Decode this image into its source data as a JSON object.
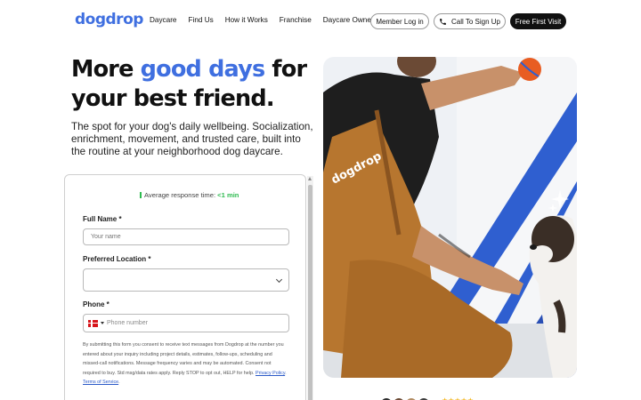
{
  "header": {
    "logo": "dogdrop",
    "nav": [
      "Daycare",
      "Find Us",
      "How it Works",
      "Franchise",
      "Daycare Owners"
    ],
    "member_login": "Member Log in",
    "call_signup": "Call To Sign Up",
    "free_visit": "Free First Visit"
  },
  "hero": {
    "headline_part1": "More ",
    "headline_accent": "good days",
    "headline_part2": " for your best friend.",
    "subcopy": "The spot for your dog's daily wellbeing. Socialization, enrichment, movement, and trusted care, built into the routine at your neighborhood dog daycare.",
    "image_brand_text": "dogdrop"
  },
  "form": {
    "response_label": "Average response time: ",
    "response_value": "<1 min",
    "full_name_label": "Full Name *",
    "full_name_placeholder": "Your name",
    "location_label": "Preferred Location *",
    "location_value": "",
    "phone_label": "Phone *",
    "phone_placeholder": "Phone number",
    "consent_text": "By submitting this form you consent to receive text messages from Dogdrop at the number you entered about your inquiry including project details, estimates, follow-ups, scheduling and missed-call notifications. Message frequency varies and may be automated. Consent not required to buy. Std msg/data rates apply. Reply STOP to opt out, HELP for help. ",
    "privacy_link": "Privacy Policy",
    "separator": ". ",
    "terms_link": "Terms of Service",
    "end": "."
  },
  "colors": {
    "accent": "#3f6fe0",
    "success": "#2dbb4f",
    "dark_button": "#111111"
  },
  "icons": [
    "phone-icon",
    "chevron-down-icon",
    "flag-icon",
    "sparkle-icon"
  ]
}
